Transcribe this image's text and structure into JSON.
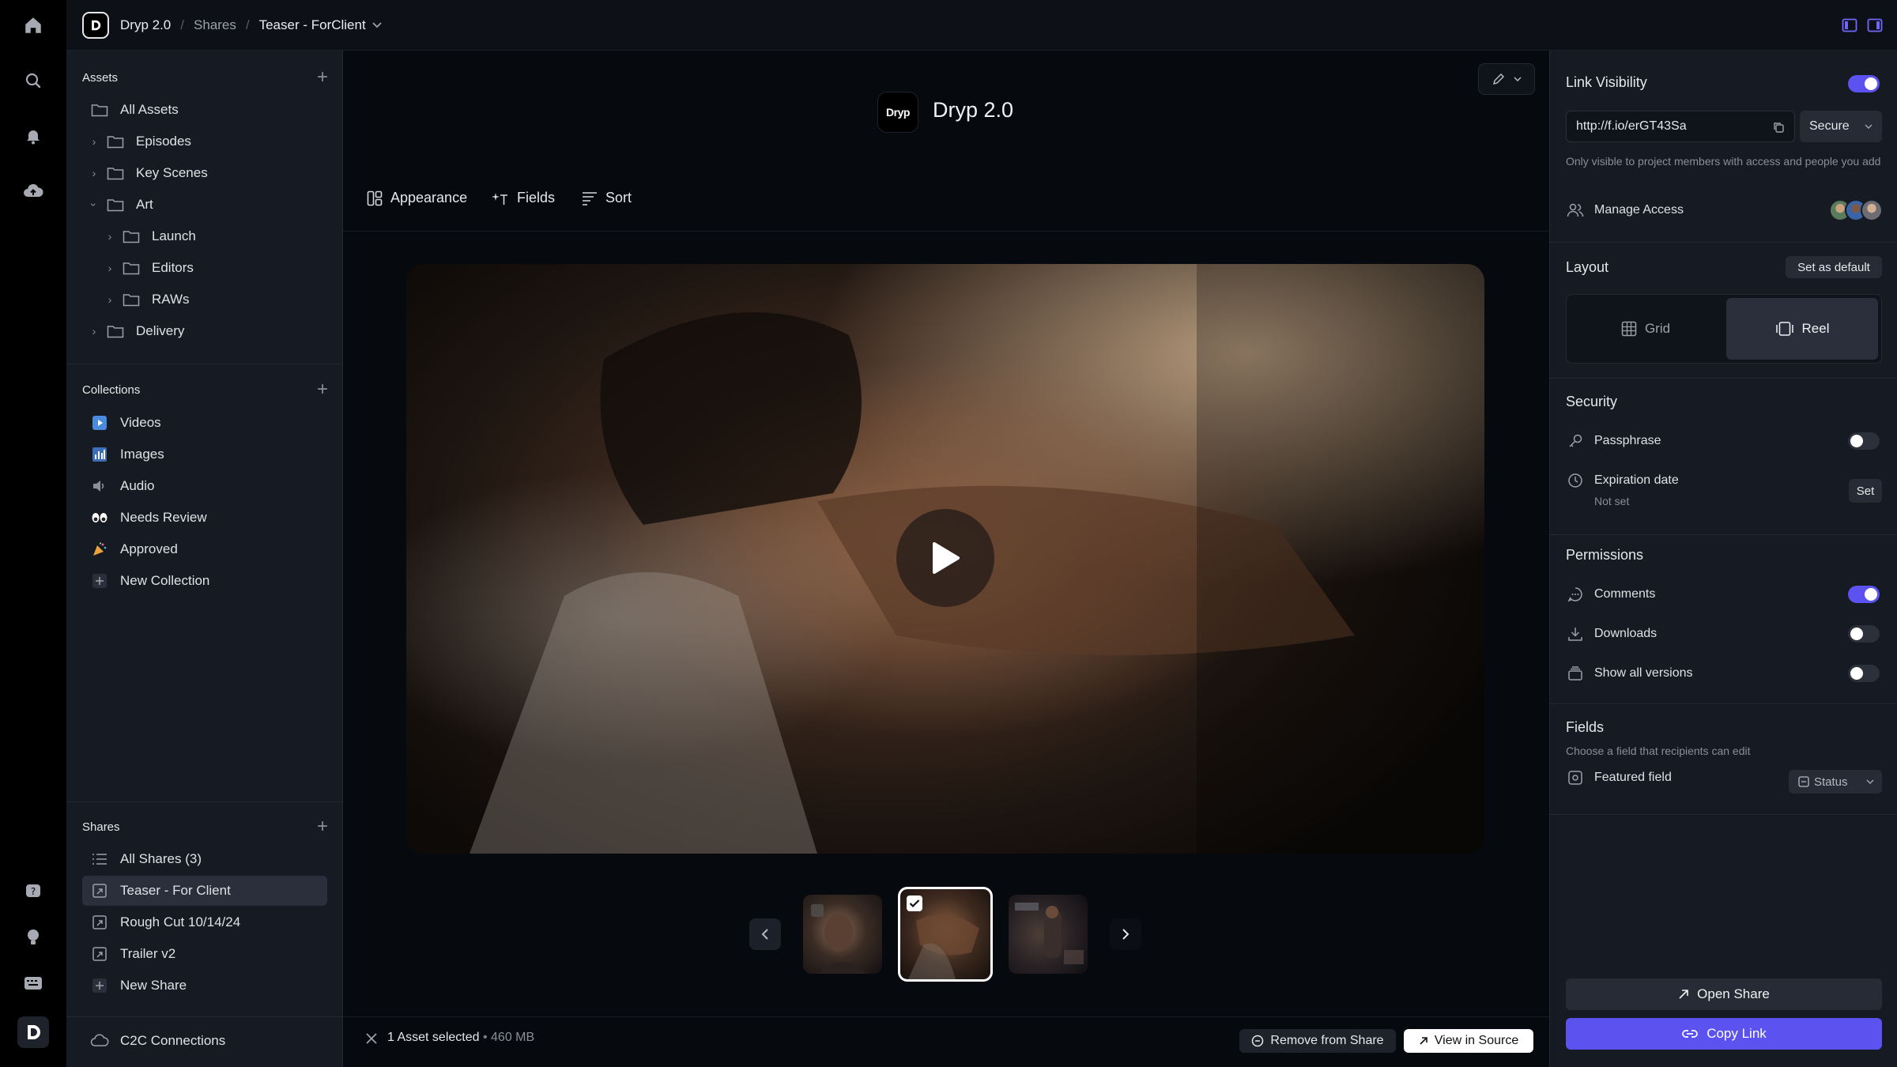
{
  "topbar": {
    "app_name": "Dryp 2.0",
    "breadcrumb_shares": "Shares",
    "breadcrumb_current": "Teaser - ForClient"
  },
  "rail": {
    "icons": [
      "home-icon",
      "search-icon",
      "bell-icon",
      "upload-cloud-icon",
      "help-icon",
      "lightbulb-icon",
      "keyboard-icon",
      "app-logo-icon"
    ]
  },
  "sidebar": {
    "assets_title": "Assets",
    "assets": [
      {
        "label": "All Assets"
      },
      {
        "label": "Episodes"
      },
      {
        "label": "Key Scenes"
      },
      {
        "label": "Art"
      },
      {
        "label": "Launch"
      },
      {
        "label": "Editors"
      },
      {
        "label": "RAWs"
      },
      {
        "label": "Delivery"
      }
    ],
    "collections_title": "Collections",
    "collections": [
      {
        "label": "Videos"
      },
      {
        "label": "Images"
      },
      {
        "label": "Audio"
      },
      {
        "label": "Needs Review"
      },
      {
        "label": "Approved"
      },
      {
        "label": "New Collection"
      }
    ],
    "shares_title": "Shares",
    "shares": [
      {
        "label": "All Shares (3)"
      },
      {
        "label": "Teaser - For Client"
      },
      {
        "label": "Rough Cut 10/14/24"
      },
      {
        "label": "Trailer v2"
      },
      {
        "label": "New Share"
      }
    ],
    "footer_label": "C2C Connections"
  },
  "main": {
    "brand_logo_text": "Dryp",
    "title": "Dryp 2.0",
    "toolbar": {
      "appearance": "Appearance",
      "fields": "Fields",
      "sort": "Sort"
    },
    "selection_text": "1 Asset selected",
    "selection_size": "460 MB",
    "remove_label": "Remove from Share",
    "view_label": "View in Source"
  },
  "panel": {
    "link_visibility": "Link Visibility",
    "url": "http://f.io/erGT43Sa",
    "secure": "Secure",
    "visibility_note": "Only visible to project members with access and people you add",
    "manage_access": "Manage Access",
    "layout_title": "Layout",
    "set_default": "Set as default",
    "grid": "Grid",
    "reel": "Reel",
    "security_title": "Security",
    "passphrase": "Passphrase",
    "expiration": "Expiration date",
    "expiration_value": "Not set",
    "set": "Set",
    "permissions_title": "Permissions",
    "comments": "Comments",
    "downloads": "Downloads",
    "show_versions": "Show all versions",
    "fields_title": "Fields",
    "fields_note": "Choose a field that recipients can edit",
    "featured_field": "Featured field",
    "status": "Status",
    "open_share": "Open Share",
    "copy_link": "Copy Link"
  },
  "toggles": {
    "link_visibility": true,
    "passphrase": false,
    "comments": true,
    "downloads": false,
    "show_versions": false
  },
  "colors": {
    "accent": "#5b52f0",
    "background": "#06090e",
    "panel": "#161a22"
  }
}
